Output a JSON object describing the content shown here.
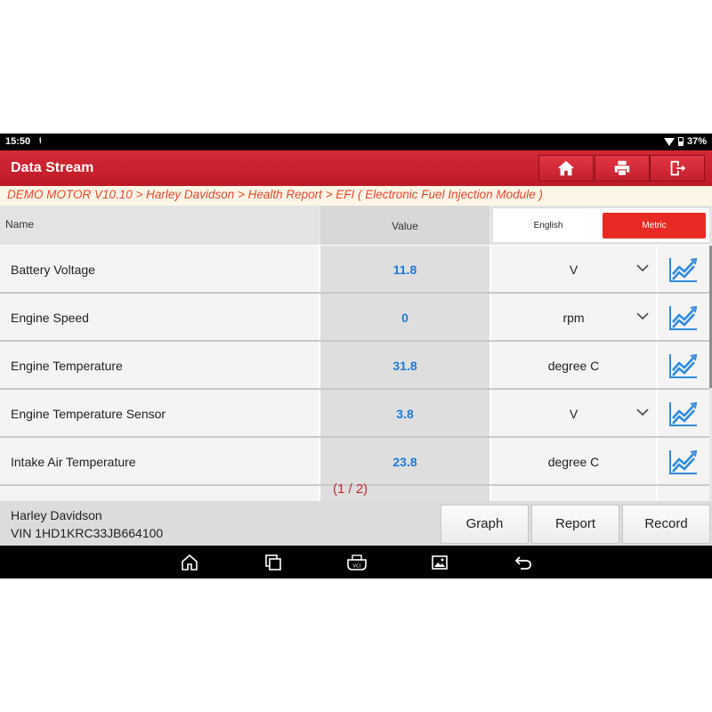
{
  "status_bar": {
    "time": "15:50",
    "usb_glyph": "⫮",
    "battery_percent": "37%"
  },
  "title_bar": {
    "title": "Data Stream",
    "icons": [
      "home-icon",
      "print-icon",
      "exit-icon"
    ]
  },
  "breadcrumb": "DEMO MOTOR V10.10 > Harley Davidson > Health Report > EFI ( Electronic Fuel Injection Module )",
  "table": {
    "headers": {
      "name": "Name",
      "value": "Value"
    },
    "unit_toggle": {
      "english": "English",
      "metric": "Metric",
      "selected": "Metric"
    },
    "rows": [
      {
        "name": "Battery Voltage",
        "value": "11.8",
        "unit": "V",
        "dropdown": true
      },
      {
        "name": "Engine Speed",
        "value": "0",
        "unit": "rpm",
        "dropdown": true
      },
      {
        "name": "Engine Temperature",
        "value": "31.8",
        "unit": "degree C",
        "dropdown": false
      },
      {
        "name": "Engine Temperature Sensor",
        "value": "3.8",
        "unit": "V",
        "dropdown": true
      },
      {
        "name": "Intake Air Temperature",
        "value": "23.8",
        "unit": "degree C",
        "dropdown": false
      }
    ]
  },
  "page_indicator": "(1 / 2)",
  "vehicle": {
    "name": "Harley Davidson",
    "vin": "VIN 1HD1KRC33JB664100"
  },
  "actions": {
    "graph": "Graph",
    "report": "Report",
    "record": "Record"
  },
  "colors": {
    "title_red": "#c8202c",
    "value_blue": "#1a7ad9",
    "metric_red": "#e82a25",
    "breadcrumb_orange": "#e5472e"
  }
}
